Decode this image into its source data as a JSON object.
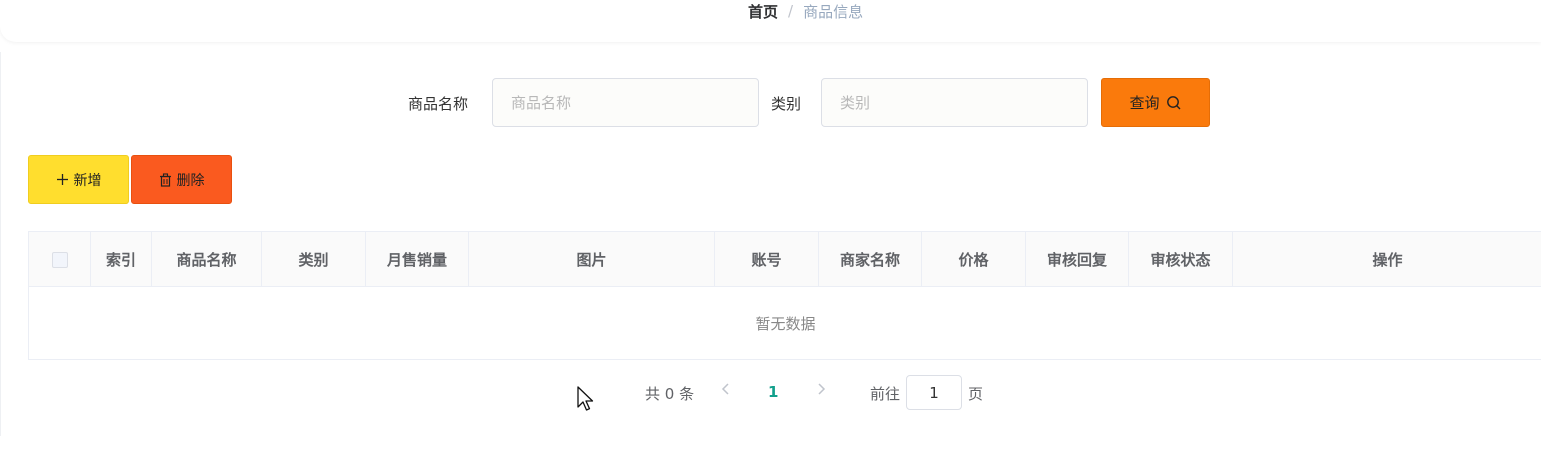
{
  "breadcrumb": {
    "home": "首页",
    "separator": "/",
    "current": "商品信息"
  },
  "search": {
    "name_label": "商品名称",
    "name_placeholder": "商品名称",
    "category_label": "类别",
    "category_placeholder": "类别",
    "query_label": "查询",
    "query_icon": "search-icon"
  },
  "toolbar": {
    "add_label": "新增",
    "add_icon": "plus-icon",
    "delete_label": "删除",
    "delete_icon": "trash-icon"
  },
  "table": {
    "columns": [
      "索引",
      "商品名称",
      "类别",
      "月售销量",
      "图片",
      "账号",
      "商家名称",
      "价格",
      "审核回复",
      "审核状态",
      "操作"
    ],
    "empty_text": "暂无数据",
    "rows": []
  },
  "pagination": {
    "total_text": "共 0 条",
    "current_page": "1",
    "goto_label": "前往",
    "goto_value": "1",
    "page_unit": "页"
  },
  "colors": {
    "query_button": "#fa7a0c",
    "add_button": "#ffde2e",
    "delete_button": "#fa5a1f",
    "active_page": "#13a08c"
  }
}
